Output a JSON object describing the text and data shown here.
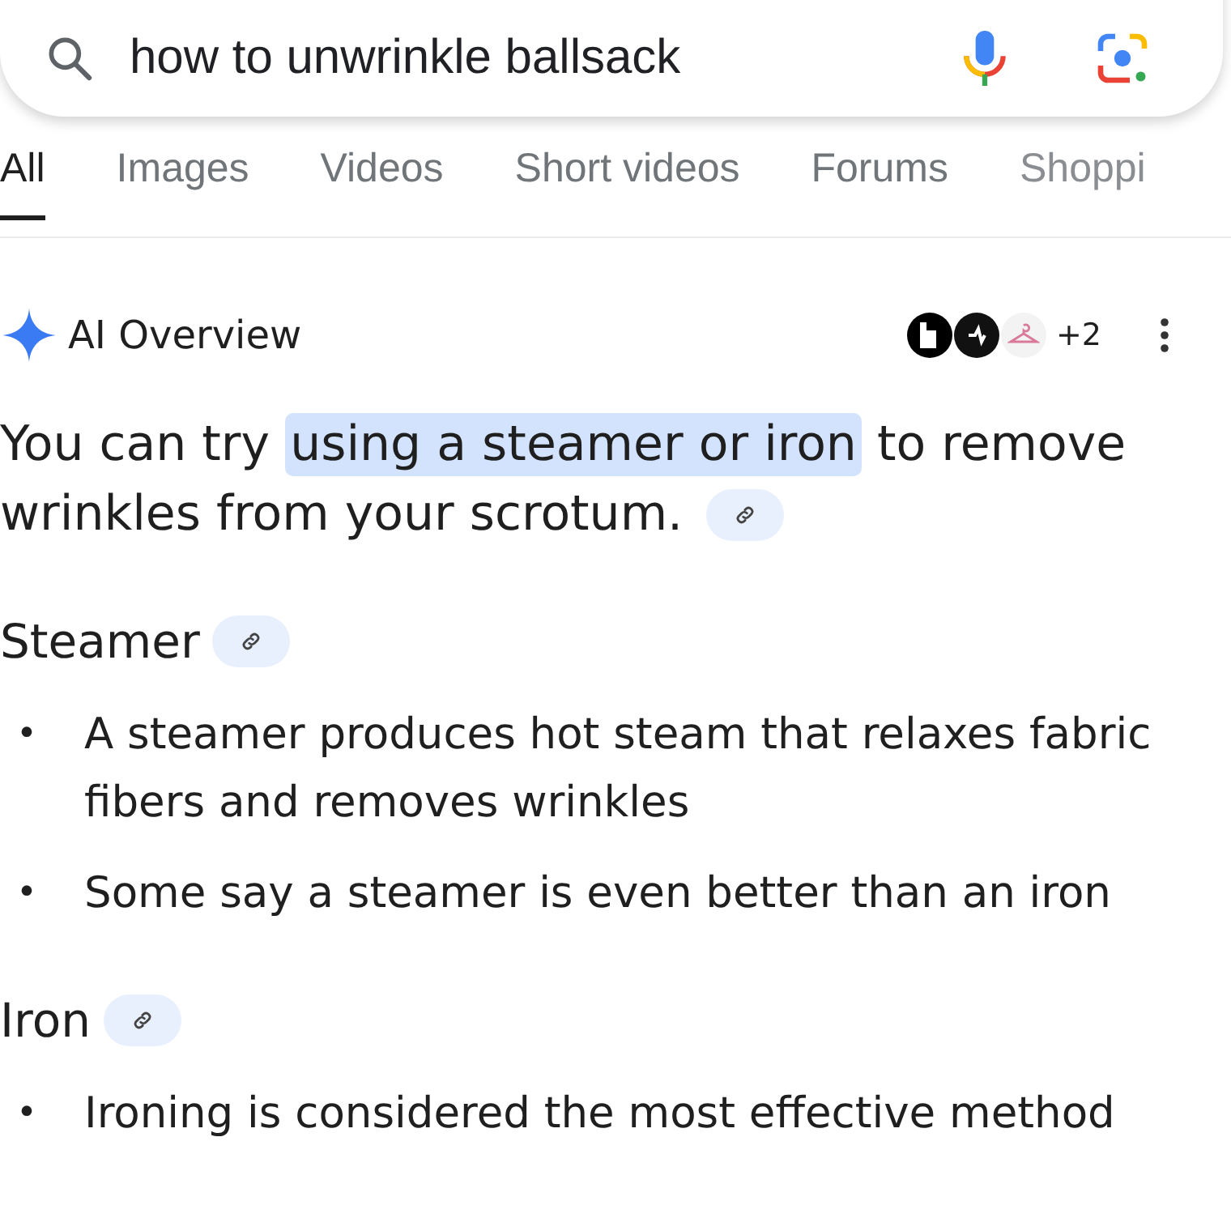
{
  "search": {
    "query": "how to unwrinkle ballsack"
  },
  "tabs": [
    {
      "label": "All",
      "selected": true
    },
    {
      "label": "Images",
      "selected": false
    },
    {
      "label": "Videos",
      "selected": false
    },
    {
      "label": "Short videos",
      "selected": false
    },
    {
      "label": "Forums",
      "selected": false
    },
    {
      "label": "Shoppi",
      "selected": false
    }
  ],
  "ai_overview": {
    "title": "AI Overview",
    "more_sources": "+2",
    "summary": {
      "before": "You can try ",
      "highlight": "using a steamer or iron",
      "after": " to remove wrinkles from your scrotum."
    },
    "sections": [
      {
        "heading": "Steamer",
        "bullets": [
          {
            "marker": "•",
            "text": "A steamer produces hot steam that relaxes fabric fibers and removes wrinkles"
          },
          {
            "marker": "•",
            "text": "Some say a steamer is even better than an iron"
          }
        ]
      },
      {
        "heading": "Iron",
        "bullets": [
          {
            "marker": "•",
            "text": "Ironing is considered the most effective method"
          }
        ]
      }
    ]
  }
}
